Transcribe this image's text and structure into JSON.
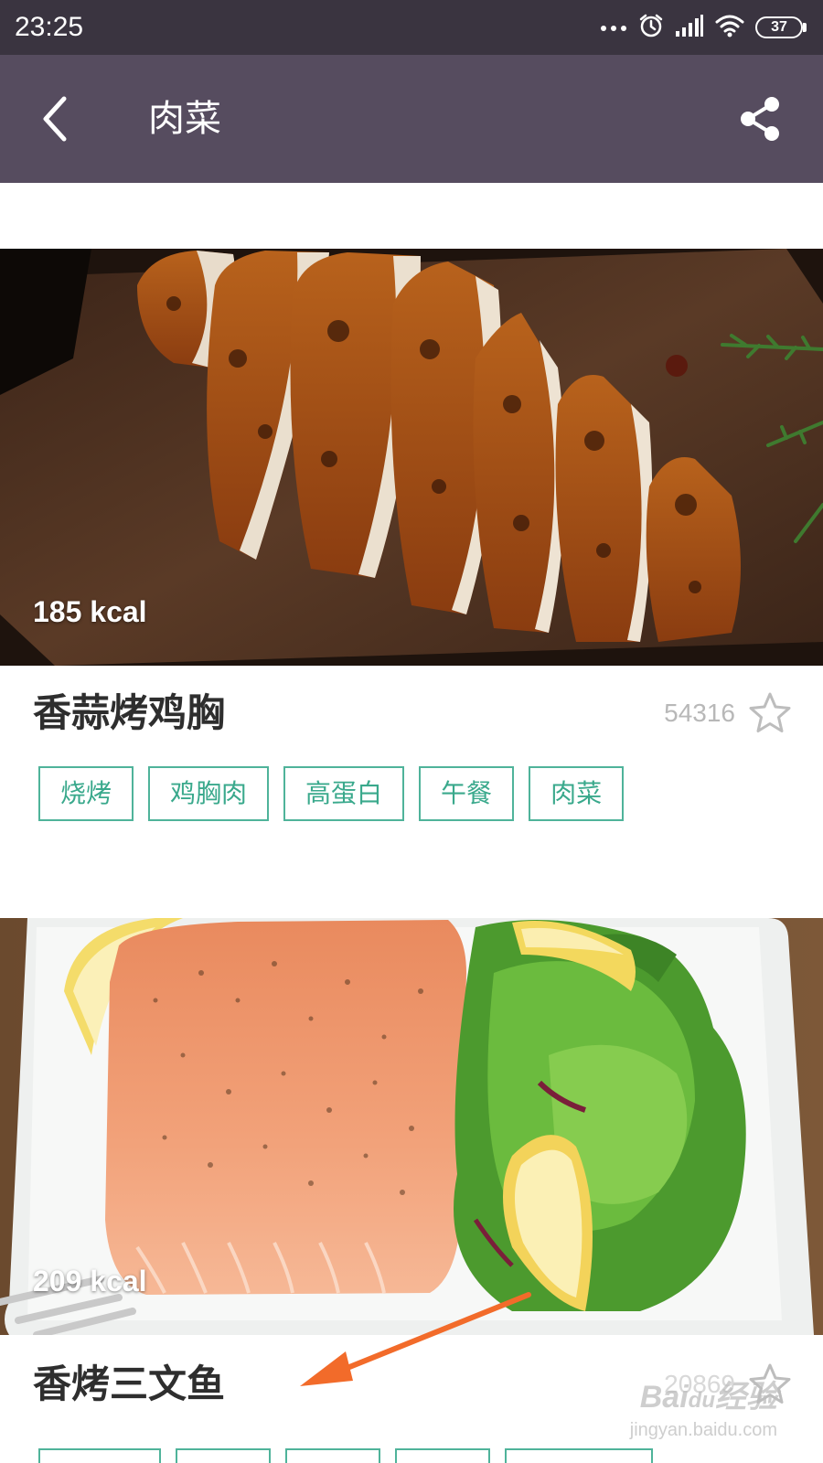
{
  "status_bar": {
    "time": "23:25",
    "battery": "37",
    "icons": [
      "more-dots-icon",
      "alarm-icon",
      "signal-icon",
      "wifi-icon",
      "battery-icon"
    ]
  },
  "app_bar": {
    "title": "肉菜",
    "back_icon": "back-chevron-icon",
    "share_icon": "share-icon",
    "background": "#564c5f"
  },
  "recipes": [
    {
      "kcal": "185 kcal",
      "title": "香蒜烤鸡胸",
      "favorites": "54316",
      "tags": [
        "烧烤",
        "鸡胸肉",
        "高蛋白",
        "午餐",
        "肉菜"
      ]
    },
    {
      "kcal": "209 kcal",
      "title": "香烤三文鱼",
      "favorites": "20869",
      "tags": []
    }
  ],
  "colors": {
    "tag_border": "#4fb39a",
    "tag_text": "#3aa98c",
    "annotation_arrow": "#f26b2a"
  },
  "watermark": {
    "main": "Bai",
    "suffix": "经验",
    "sub": "jingyan.baidu.com"
  }
}
